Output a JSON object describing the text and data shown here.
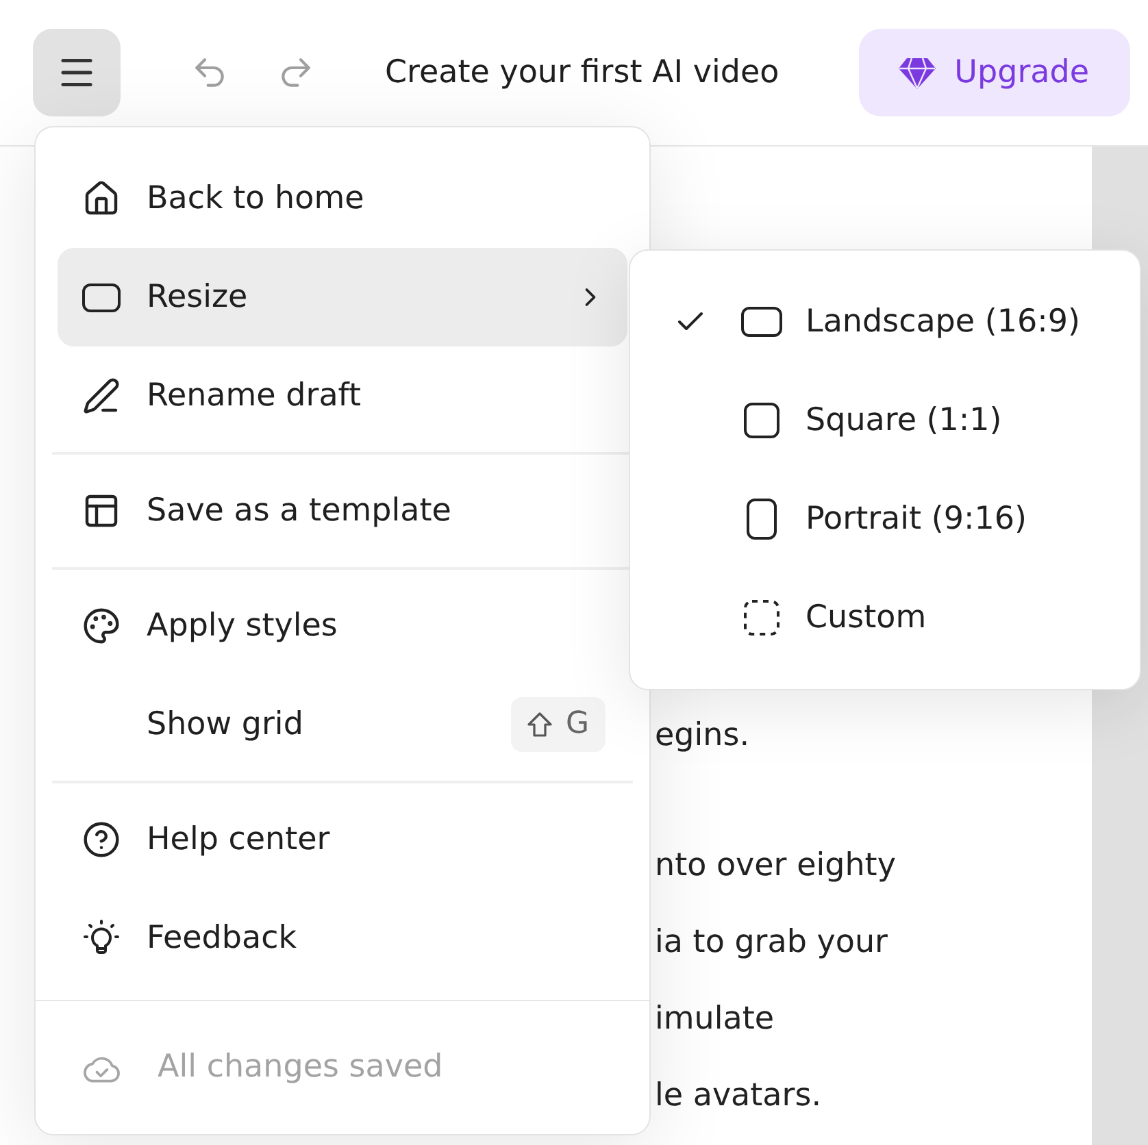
{
  "top_bar": {
    "title": "Create your first AI video",
    "upgrade_button": "Upgrade"
  },
  "document": {
    "paragraphs": [
      [
        "egins."
      ],
      [
        "nto over eighty",
        "ia to grab your",
        "imulate",
        "le avatars."
      ]
    ]
  },
  "menu": {
    "sections": [
      {
        "items": [
          {
            "label": "Back to home",
            "kind": "action",
            "selected": false
          },
          {
            "label": "Resize",
            "kind": "submenu",
            "selected": true
          },
          {
            "label": "Rename draft",
            "kind": "action",
            "selected": false
          }
        ]
      },
      {
        "items": [
          {
            "label": "Save as a template",
            "kind": "action",
            "selected": false
          }
        ]
      },
      {
        "items": [
          {
            "label": "Apply styles",
            "kind": "action",
            "selected": false
          },
          {
            "label": "Show grid",
            "kind": "action",
            "selected": false,
            "shortcut": "G"
          }
        ]
      },
      {
        "items": [
          {
            "label": "Help center",
            "kind": "action",
            "selected": false
          },
          {
            "label": "Feedback",
            "kind": "action",
            "selected": false
          }
        ]
      }
    ],
    "status": "All changes saved"
  },
  "resize_submenu": {
    "items": [
      {
        "label": "Landscape (16:9)",
        "checked": true
      },
      {
        "label": "Square (1:1)",
        "checked": false
      },
      {
        "label": "Portrait (9:16)",
        "checked": false
      },
      {
        "label": "Custom",
        "checked": false
      }
    ]
  }
}
